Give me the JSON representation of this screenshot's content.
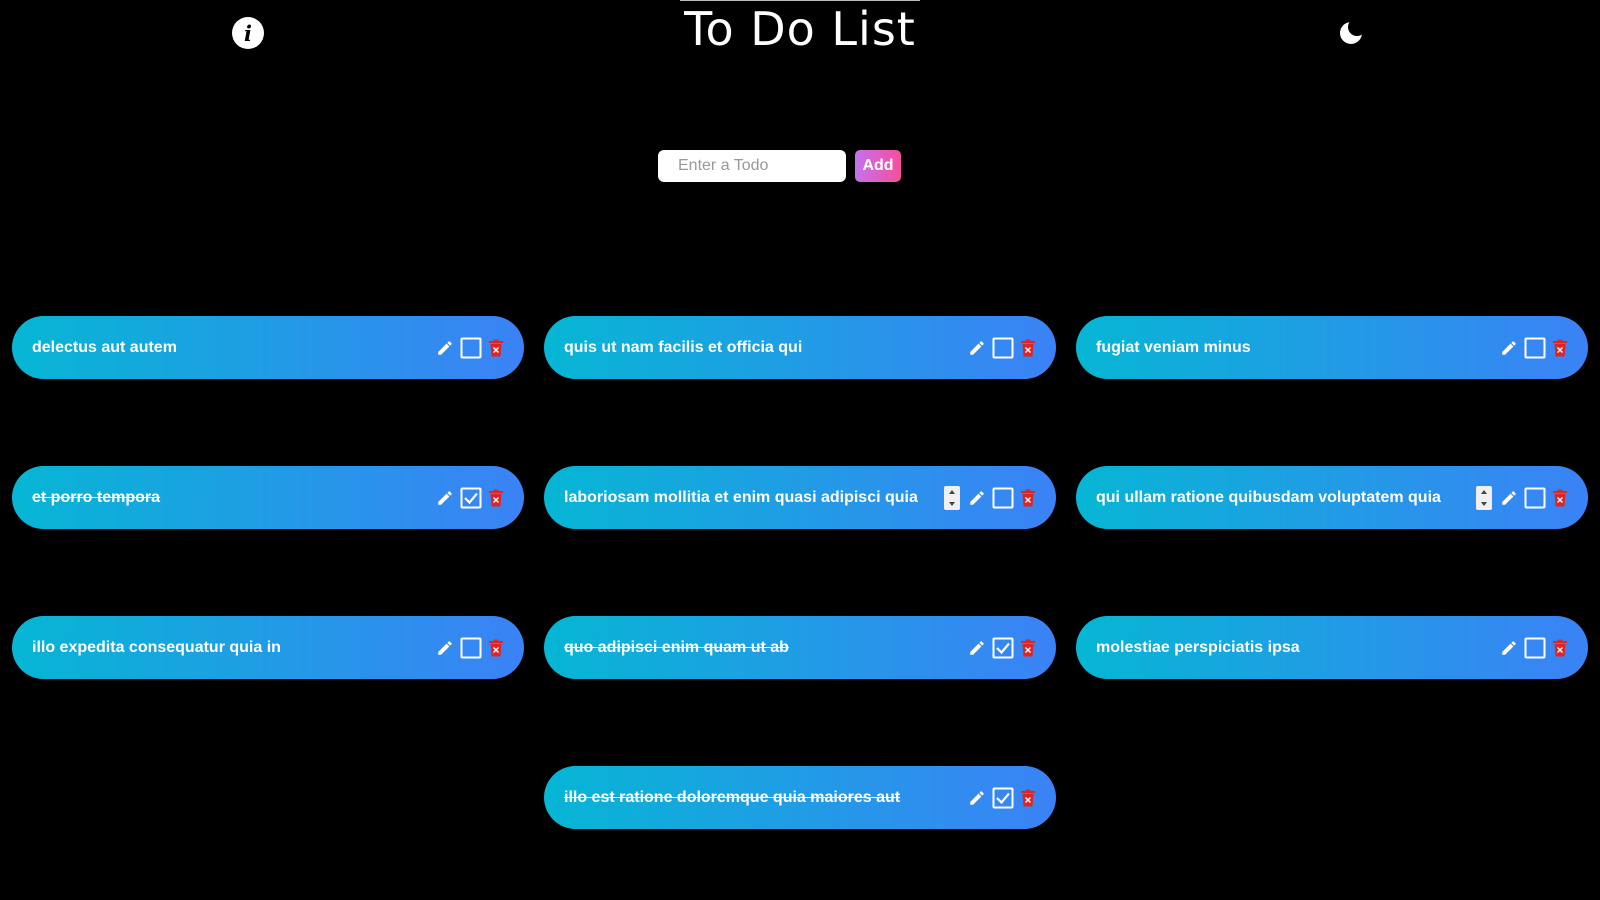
{
  "header": {
    "title": "To Do List",
    "info_icon": "info-icon",
    "theme_icon": "moon-icon"
  },
  "form": {
    "placeholder": "Enter a Todo",
    "add_label": "Add"
  },
  "colors": {
    "background": "#000000",
    "card_gradient_start": "#06b6d4",
    "card_gradient_end": "#3b82f6",
    "add_gradient_start": "#c471ed",
    "add_gradient_end": "#f64f9c",
    "delete_icon": "#dc2626"
  },
  "todos": [
    {
      "text": "delectus aut autem",
      "done": false,
      "editing": false
    },
    {
      "text": "quis ut nam facilis et officia qui",
      "done": false,
      "editing": false
    },
    {
      "text": "fugiat veniam minus",
      "done": false,
      "editing": false
    },
    {
      "text": "et porro tempora",
      "done": true,
      "editing": false
    },
    {
      "text": "laboriosam mollitia et enim quasi adipisci quia",
      "done": false,
      "editing": true
    },
    {
      "text": "qui ullam ratione quibusdam voluptatem quia",
      "done": false,
      "editing": true
    },
    {
      "text": "illo expedita consequatur quia in",
      "done": false,
      "editing": false
    },
    {
      "text": "quo adipisci enim quam ut ab",
      "done": true,
      "editing": false
    },
    {
      "text": "molestiae perspiciatis ipsa",
      "done": false,
      "editing": false
    },
    {
      "text": "illo est ratione doloremque quia maiores aut",
      "done": true,
      "editing": false
    }
  ]
}
